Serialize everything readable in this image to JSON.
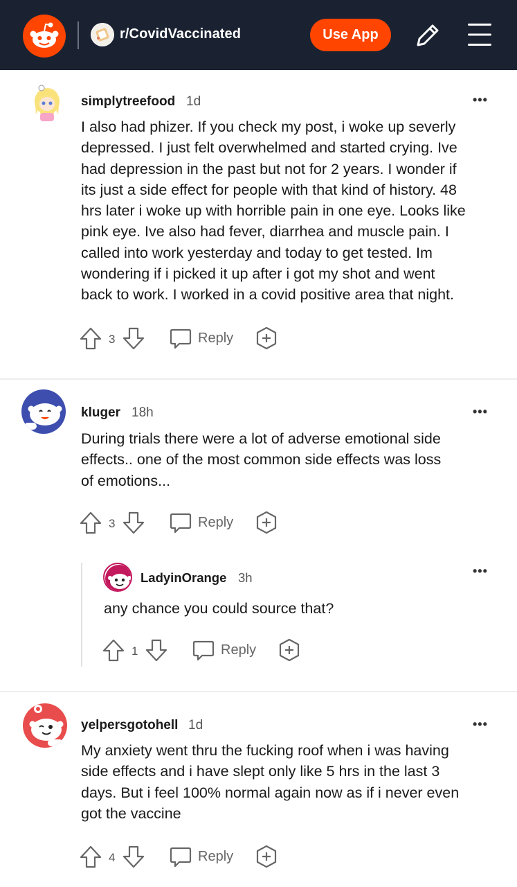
{
  "header": {
    "subreddit": "r/CovidVaccinated",
    "use_app_label": "Use App",
    "brand_color": "#ff4500",
    "bar_color": "#1a2232"
  },
  "comments": [
    {
      "username": "simplytreefood",
      "age": "1d",
      "more": "•••",
      "lines": [
        "I also had phizer. If you check my post, i woke up severly",
        "depressed. I just felt overwhelmed and started crying. Ive",
        "had depression in the past but not for 2 years. I wonder if",
        "its just a side effect for people with that kind of history. 48",
        "hrs later i woke up with horrible pain in one eye. Looks like",
        "pink eye. Ive also had fever, diarrhea and muscle pain. I",
        "called into work yesterday and today to get tested. Im",
        "wondering if i picked it up after i got my shot and went",
        "back to work. I worked in a covid positive area that night."
      ],
      "votes": "3",
      "reply_label": "Reply"
    },
    {
      "username": "kluger",
      "age": "18h",
      "more": "•••",
      "lines": [
        "During trials there were a lot of adverse emotional side",
        "effects.. one of the most common side effects was loss",
        "of emotions..."
      ],
      "votes": "3",
      "reply_label": "Reply"
    },
    {
      "username": "LadyinOrange",
      "age": "3h",
      "more": "•••",
      "lines": [
        "any chance you could source that?"
      ],
      "votes": "1",
      "reply_label": "Reply"
    },
    {
      "username": "yelpersgotohell",
      "age": "1d",
      "more": "•••",
      "lines": [
        "My anxiety went thru the fucking roof when i was having",
        "side effects and i have slept only like 5 hrs in the last 3",
        "days. But i feel 100% normal again now as if i never even",
        "got the vaccine"
      ],
      "votes": "4",
      "reply_label": "Reply"
    }
  ]
}
